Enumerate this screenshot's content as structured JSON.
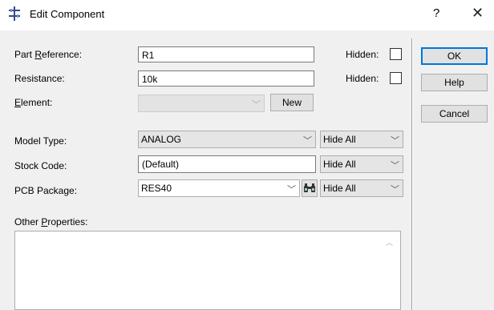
{
  "window": {
    "title": "Edit Component",
    "help_glyph": "?",
    "close_glyph": "✕"
  },
  "fields": {
    "part_reference": {
      "label_pre": "Part ",
      "label_ul": "R",
      "label_post": "eference:",
      "value": "R1",
      "hidden_label": "Hidden:"
    },
    "resistance": {
      "label": "Resistance:",
      "value": "10k",
      "hidden_label": "Hidden:"
    },
    "element": {
      "label_ul": "E",
      "label_post": "lement:",
      "value": "",
      "new_label": "New"
    },
    "model_type": {
      "label": "Model Type:",
      "value": "ANALOG",
      "visibility": "Hide All"
    },
    "stock_code": {
      "label": "Stock Code:",
      "value": "(Default)",
      "visibility": "Hide All"
    },
    "pcb_package": {
      "label": "PCB Package:",
      "value": "RES40",
      "visibility": "Hide All"
    },
    "other_properties": {
      "label_pre": "Other ",
      "label_ul": "P",
      "label_post": "roperties:",
      "value": ""
    }
  },
  "buttons": {
    "ok": "OK",
    "help": "Help",
    "cancel": "Cancel"
  },
  "icons": {
    "app": "component-icon",
    "browse": "binoculars-icon",
    "dropdown": "chevron-down-icon"
  }
}
